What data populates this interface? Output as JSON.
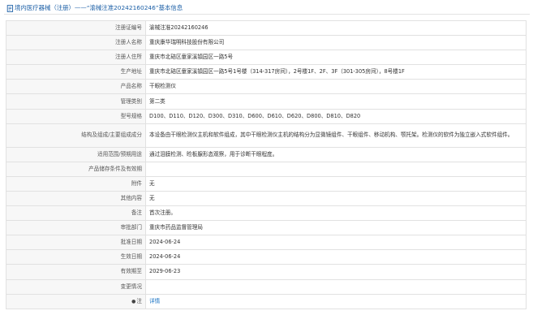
{
  "header": {
    "title": "境内医疗器械（注册）——“渝械注准20242160246”基本信息"
  },
  "rows": [
    {
      "label": "注册证编号",
      "value": "渝械注准20242160246"
    },
    {
      "label": "注册人名称",
      "value": "重庆康华瑞明科技股份有限公司"
    },
    {
      "label": "注册人住所",
      "value": "重庆市北碚区童家溪镇园区一路5号"
    },
    {
      "label": "生产地址",
      "value": "重庆市北碚区童家溪镇园区一路5号1号楼（314-317房间），2号楼1F、2F、3F（301-305房间），8号楼1F"
    },
    {
      "label": "产品名称",
      "value": "干眼检测仪"
    },
    {
      "label": "管理类别",
      "value": "第二类"
    },
    {
      "label": "型号规格",
      "value": "D100、D110、D120、D300、D310、D600、D610、D620、D800、D810、D820"
    },
    {
      "label": "结构及组成/主要组成成分",
      "value": "本设备由干眼检测仪主机和软件组成，其中干眼检测仪主机的结构分为显微镜组件、干眼组件、移动机构、颚托架。检测仪的软件为独立嵌入式软件组件。"
    },
    {
      "label": "适用范围/预期用途",
      "value": "通过泪膜检测、睑板腺形态观察，用于诊断干眼程度。"
    },
    {
      "label": "产品储存条件及有效期",
      "value": ""
    },
    {
      "label": "附件",
      "value": "无"
    },
    {
      "label": "其他内容",
      "value": "无"
    },
    {
      "label": "备注",
      "value": "首次注册。"
    },
    {
      "label": "审批部门",
      "value": "重庆市药品监督管理局"
    },
    {
      "label": "批准日期",
      "value": "2024-06-24"
    },
    {
      "label": "生效日期",
      "value": "2024-06-24"
    },
    {
      "label": "有效期至",
      "value": "2029-06-23"
    },
    {
      "label": "变更情况",
      "value": ""
    },
    {
      "label": "注",
      "value": "详情"
    }
  ],
  "colors": {
    "link": "#1a73c4",
    "header": "#1a5ea6",
    "label_bg": "#f7f7f7",
    "border": "#e1e1e1"
  },
  "icons": {
    "header": "document-icon",
    "note": "pin-icon"
  }
}
